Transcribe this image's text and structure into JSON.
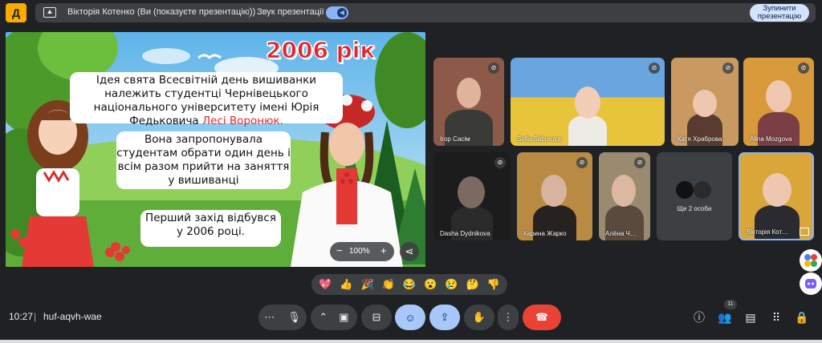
{
  "topbar": {
    "logo_text": "Д",
    "presenter_label": "Вікторія Котенко (Ви (показуєте презентацію))",
    "sound_label": "Звук презентації",
    "stop_button": "Зупинити презентацію"
  },
  "slide": {
    "title": "2006 рік",
    "bubble1_text": "Ідея свята Всесвітній день вишиванки належить студентці Чернівецького національного університету імені Юрія Федьковича",
    "bubble1_name": "Лесі Воронюк.",
    "bubble2_text": "Вона запропонувала студентам обрати один день і всім разом прийти на заняття у вишиванці",
    "bubble3_text": "Перший захід відбувся у 2006 році.",
    "zoom": "100%",
    "zoom_out": "−",
    "zoom_in": "+",
    "share_icon": "share-icon"
  },
  "participants": [
    {
      "name": "Ігор Сасім",
      "muted": true
    },
    {
      "name": "Sofia Saburova",
      "muted": true
    },
    {
      "name": "Катя Храброва",
      "muted": true
    },
    {
      "name": "Alina Mozgova",
      "muted": true
    },
    {
      "name": "Dasha Dydnikova",
      "muted": true
    },
    {
      "name": "Карина Жарко",
      "muted": true
    },
    {
      "name": "Алёна Ч…",
      "muted": true
    },
    {
      "name": "Вікторія Кот…",
      "muted": false
    }
  ],
  "more_people": "Ще 2 особи",
  "reactions": [
    "💖",
    "👍",
    "🎉",
    "👏",
    "😂",
    "😮",
    "😢",
    "🤔",
    "👎"
  ],
  "bottombar": {
    "time": "10:27",
    "separator": "|",
    "meeting_code": "huf-aqvh-wae",
    "people_count": "11"
  },
  "colors": {
    "background": "#202124",
    "control": "#3c4043",
    "accent": "#a8c7fa",
    "end_call": "#ea4335",
    "title_red": "#e8232a"
  }
}
